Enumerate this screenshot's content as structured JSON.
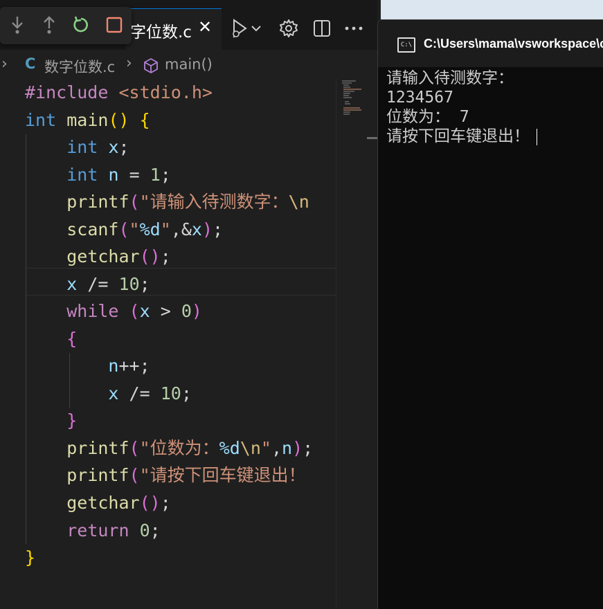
{
  "editor": {
    "tab": {
      "label": "字位数.c",
      "close_symbol": "✕"
    },
    "debug_toolbar": {
      "buttons": [
        "step-over-icon",
        "step-out-icon",
        "restart-icon",
        "stop-icon"
      ]
    },
    "tab_actions": [
      "run-debug-icon",
      "settings-icon",
      "split-editor-icon",
      "more-actions-icon"
    ],
    "breadcrumb": {
      "file_icon": "C",
      "file": "数字位数.c",
      "separator": "›",
      "symbol": "main()"
    },
    "code_lines": [
      "#include <stdio.h>",
      "int main() {",
      "int x;",
      "int n = 1;",
      "printf(\"请输入待测数字：\\n",
      "scanf(\"%d\",&x);",
      "getchar();",
      "x /= 10;",
      "while (x > 0)",
      "{",
      "n++;",
      "x /= 10;",
      "}",
      "printf(\"位数为：%d\\n\",n);",
      "printf(\"请按下回车键退出！",
      "getchar();",
      "return 0;",
      "}"
    ]
  },
  "terminal": {
    "title": "C:\\Users\\mama\\vsworkspace\\c",
    "icon_text": "C:\\",
    "lines": [
      "请输入待测数字：",
      "1234567",
      "位数为： 7",
      "请按下回车键退出！"
    ]
  }
}
